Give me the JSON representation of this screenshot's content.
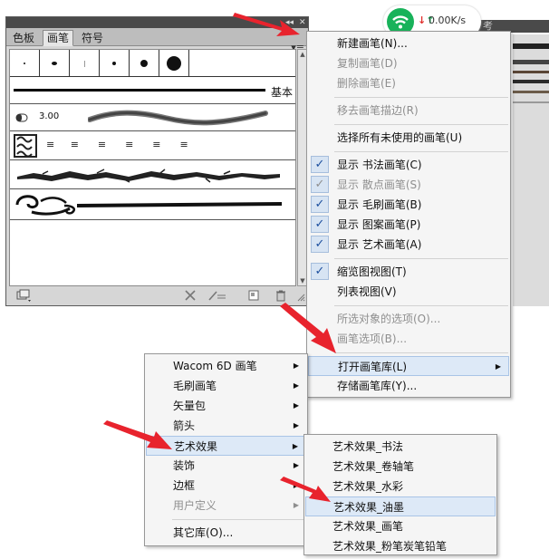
{
  "panel": {
    "tabs": [
      "色板",
      "画笔",
      "符号"
    ],
    "active_tab": "画笔",
    "menu_button_icon": "panel-menu-icon",
    "basic_label": "基本",
    "calligraphic_size": "3.00",
    "window_controls": {
      "collapse": "◂◂",
      "close": "✕"
    },
    "bottom_icons": [
      "brush-libraries-menu-icon",
      "remove-brush-stroke-icon",
      "brush-options-icon",
      "new-brush-icon",
      "delete-brush-icon",
      "resize-grip-icon"
    ]
  },
  "network_widget": {
    "speed_text": "0.00K/s",
    "accent_color": "#18b25a",
    "arrow_glyph": "⇅"
  },
  "background_window": {
    "tab_label": "考"
  },
  "main_menu": {
    "items": [
      {
        "label": "新建画笔(N)...",
        "enabled": true
      },
      {
        "label": "复制画笔(D)",
        "enabled": false
      },
      {
        "label": "删除画笔(E)",
        "enabled": false
      },
      {
        "label": "移去画笔描边(R)",
        "enabled": false
      },
      {
        "label": "选择所有未使用的画笔(U)",
        "enabled": true
      },
      {
        "label": "显示 书法画笔(C)",
        "enabled": true,
        "checked": true
      },
      {
        "label": "显示 散点画笔(S)",
        "enabled": false,
        "checked": true
      },
      {
        "label": "显示 毛刷画笔(B)",
        "enabled": true,
        "checked": true
      },
      {
        "label": "显示 图案画笔(P)",
        "enabled": true,
        "checked": true
      },
      {
        "label": "显示 艺术画笔(A)",
        "enabled": true,
        "checked": true
      },
      {
        "label": "缩览图视图(T)",
        "enabled": true,
        "checked": true
      },
      {
        "label": "列表视图(V)",
        "enabled": true
      },
      {
        "label": "所选对象的选项(O)...",
        "enabled": false
      },
      {
        "label": "画笔选项(B)...",
        "enabled": false
      },
      {
        "label": "打开画笔库(L)",
        "enabled": true,
        "submenu": true,
        "highlighted": true
      },
      {
        "label": "存储画笔库(Y)...",
        "enabled": true
      }
    ]
  },
  "library_menu": {
    "items": [
      {
        "label": "Wacom 6D 画笔",
        "submenu": true
      },
      {
        "label": "毛刷画笔",
        "submenu": true
      },
      {
        "label": "矢量包",
        "submenu": true
      },
      {
        "label": "箭头",
        "submenu": true
      },
      {
        "label": "艺术效果",
        "submenu": true,
        "highlighted": true
      },
      {
        "label": "装饰",
        "submenu": true
      },
      {
        "label": "边框",
        "submenu": true
      },
      {
        "label": "用户定义",
        "submenu": true,
        "enabled": false
      },
      {
        "label": "其它库(O)..."
      }
    ]
  },
  "art_menu": {
    "items": [
      {
        "label": "艺术效果_书法"
      },
      {
        "label": "艺术效果_卷轴笔"
      },
      {
        "label": "艺术效果_水彩"
      },
      {
        "label": "艺术效果_油墨",
        "highlighted": true
      },
      {
        "label": "艺术效果_画笔"
      },
      {
        "label": "艺术效果_粉笔炭笔铅笔"
      }
    ]
  },
  "colors": {
    "highlight": "#dde9f7",
    "check": "#1d4f9e",
    "annotation_arrow": "#e8232d"
  }
}
